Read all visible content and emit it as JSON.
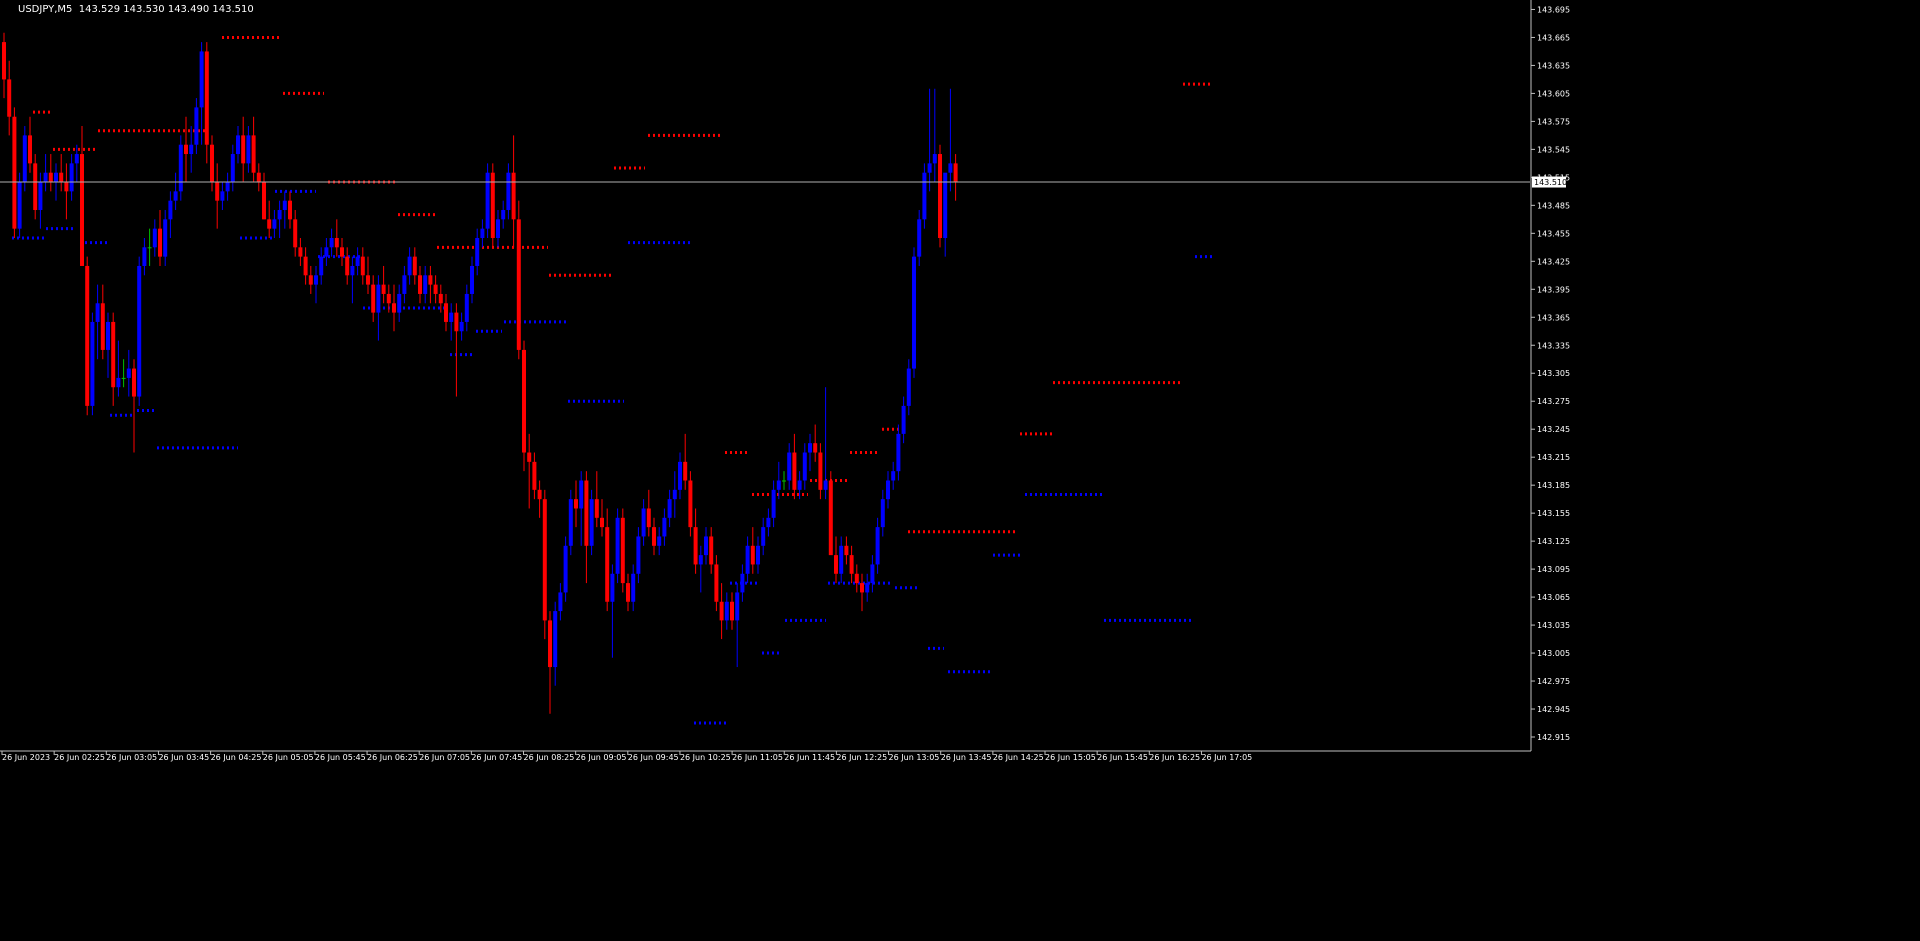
{
  "title": {
    "symbol": "USDJPY,M5",
    "ohlc": "143.529 143.530 143.490 143.510"
  },
  "colors": {
    "background": "#000000",
    "axis": "#c0c0c0",
    "text": "#ffffff",
    "bull": "#0000ff",
    "bear": "#ff0000",
    "doji": "#00c000",
    "bid_line": "#b0b0b0",
    "resistance": "#ff0000",
    "support": "#0000ff"
  },
  "chart_data": {
    "type": "candlestick",
    "symbol": "USDJPY",
    "timeframe": "M5",
    "ylim": [
      142.9,
      143.703
    ],
    "y_ticks": [
      "143.695",
      "143.665",
      "143.635",
      "143.605",
      "143.575",
      "143.545",
      "143.515",
      "143.485",
      "143.455",
      "143.425",
      "143.395",
      "143.365",
      "143.335",
      "143.305",
      "143.275",
      "143.245",
      "143.215",
      "143.185",
      "143.155",
      "143.125",
      "143.095",
      "143.065",
      "143.035",
      "143.005",
      "142.975",
      "142.945",
      "142.915"
    ],
    "x_ticks": [
      "26 Jun 2023",
      "26 Jun 02:25",
      "26 Jun 03:05",
      "26 Jun 03:45",
      "26 Jun 04:25",
      "26 Jun 05:05",
      "26 Jun 05:45",
      "26 Jun 06:25",
      "26 Jun 07:05",
      "26 Jun 07:45",
      "26 Jun 08:25",
      "26 Jun 09:05",
      "26 Jun 09:45",
      "26 Jun 10:25",
      "26 Jun 11:05",
      "26 Jun 11:45",
      "26 Jun 12:25",
      "26 Jun 13:05",
      "26 Jun 13:45",
      "26 Jun 14:25",
      "26 Jun 15:05",
      "26 Jun 15:45",
      "26 Jun 16:25",
      "26 Jun 17:05"
    ],
    "bid": "143.510",
    "candles": [
      [
        143.66,
        143.67,
        143.6,
        143.62
      ],
      [
        143.62,
        143.64,
        143.56,
        143.58
      ],
      [
        143.58,
        143.59,
        143.45,
        143.46
      ],
      [
        143.46,
        143.52,
        143.45,
        143.51
      ],
      [
        143.51,
        143.57,
        143.5,
        143.56
      ],
      [
        143.56,
        143.58,
        143.52,
        143.53
      ],
      [
        143.53,
        143.54,
        143.47,
        143.48
      ],
      [
        143.48,
        143.52,
        143.46,
        143.51
      ],
      [
        143.51,
        143.54,
        143.5,
        143.52
      ],
      [
        143.52,
        143.54,
        143.5,
        143.51
      ],
      [
        143.51,
        143.53,
        143.49,
        143.52
      ],
      [
        143.52,
        143.54,
        143.5,
        143.51
      ],
      [
        143.51,
        143.53,
        143.47,
        143.5
      ],
      [
        143.5,
        143.54,
        143.49,
        143.53
      ],
      [
        143.53,
        143.55,
        143.51,
        143.54
      ],
      [
        143.54,
        143.57,
        143.44,
        143.42
      ],
      [
        143.42,
        143.43,
        143.26,
        143.27
      ],
      [
        143.27,
        143.37,
        143.26,
        143.36
      ],
      [
        143.36,
        143.4,
        143.32,
        143.38
      ],
      [
        143.38,
        143.4,
        143.32,
        143.33
      ],
      [
        143.33,
        143.37,
        143.3,
        143.36
      ],
      [
        143.36,
        143.37,
        143.27,
        143.29
      ],
      [
        143.29,
        143.34,
        143.28,
        143.3
      ],
      [
        143.3,
        143.32,
        143.29,
        143.3
      ],
      [
        143.3,
        143.33,
        143.28,
        143.31
      ],
      [
        143.31,
        143.32,
        143.22,
        143.28
      ],
      [
        143.28,
        143.43,
        143.27,
        143.42
      ],
      [
        143.42,
        143.45,
        143.41,
        143.44
      ],
      [
        143.44,
        143.46,
        143.42,
        143.44
      ],
      [
        143.44,
        143.47,
        143.43,
        143.46
      ],
      [
        143.46,
        143.48,
        143.42,
        143.43
      ],
      [
        143.43,
        143.48,
        143.42,
        143.47
      ],
      [
        143.47,
        143.5,
        143.45,
        143.49
      ],
      [
        143.49,
        143.52,
        143.48,
        143.5
      ],
      [
        143.5,
        143.56,
        143.49,
        143.55
      ],
      [
        143.55,
        143.58,
        143.51,
        143.54
      ],
      [
        143.54,
        143.57,
        143.52,
        143.55
      ],
      [
        143.55,
        143.6,
        143.54,
        143.59
      ],
      [
        143.59,
        143.66,
        143.55,
        143.65
      ],
      [
        143.65,
        143.66,
        143.53,
        143.55
      ],
      [
        143.55,
        143.56,
        143.5,
        143.51
      ],
      [
        143.51,
        143.53,
        143.46,
        143.49
      ],
      [
        143.49,
        143.51,
        143.48,
        143.5
      ],
      [
        143.5,
        143.52,
        143.49,
        143.51
      ],
      [
        143.51,
        143.55,
        143.5,
        143.54
      ],
      [
        143.54,
        143.57,
        143.53,
        143.56
      ],
      [
        143.56,
        143.58,
        143.51,
        143.53
      ],
      [
        143.53,
        143.57,
        143.52,
        143.56
      ],
      [
        143.56,
        143.58,
        143.51,
        143.52
      ],
      [
        143.52,
        143.53,
        143.5,
        143.51
      ],
      [
        143.51,
        143.52,
        143.47,
        143.47
      ],
      [
        143.47,
        143.49,
        143.45,
        143.46
      ],
      [
        143.46,
        143.48,
        143.45,
        143.47
      ],
      [
        143.47,
        143.49,
        143.45,
        143.48
      ],
      [
        143.48,
        143.5,
        143.46,
        143.49
      ],
      [
        143.49,
        143.5,
        143.46,
        143.47
      ],
      [
        143.47,
        143.48,
        143.43,
        143.44
      ],
      [
        143.44,
        143.45,
        143.42,
        143.43
      ],
      [
        143.43,
        143.44,
        143.4,
        143.41
      ],
      [
        143.41,
        143.42,
        143.39,
        143.4
      ],
      [
        143.4,
        143.42,
        143.38,
        143.41
      ],
      [
        143.41,
        143.44,
        143.4,
        143.43
      ],
      [
        143.43,
        143.45,
        143.42,
        143.44
      ],
      [
        143.44,
        143.46,
        143.43,
        143.45
      ],
      [
        143.45,
        143.47,
        143.43,
        143.44
      ],
      [
        143.44,
        143.45,
        143.42,
        143.43
      ],
      [
        143.43,
        143.44,
        143.4,
        143.41
      ],
      [
        143.41,
        143.43,
        143.38,
        143.42
      ],
      [
        143.42,
        143.44,
        143.41,
        143.43
      ],
      [
        143.43,
        143.44,
        143.4,
        143.41
      ],
      [
        143.41,
        143.43,
        143.39,
        143.4
      ],
      [
        143.4,
        143.41,
        143.36,
        143.37
      ],
      [
        143.37,
        143.41,
        143.34,
        143.4
      ],
      [
        143.4,
        143.42,
        143.38,
        143.39
      ],
      [
        143.39,
        143.4,
        143.37,
        143.38
      ],
      [
        143.38,
        143.4,
        143.35,
        143.37
      ],
      [
        143.37,
        143.4,
        143.36,
        143.39
      ],
      [
        143.39,
        143.42,
        143.38,
        143.41
      ],
      [
        143.41,
        143.44,
        143.4,
        143.43
      ],
      [
        143.43,
        143.44,
        143.4,
        143.41
      ],
      [
        143.41,
        143.42,
        143.38,
        143.39
      ],
      [
        143.39,
        143.42,
        143.38,
        143.41
      ],
      [
        143.41,
        143.42,
        143.38,
        143.4
      ],
      [
        143.4,
        143.41,
        143.38,
        143.39
      ],
      [
        143.39,
        143.4,
        143.37,
        143.38
      ],
      [
        143.38,
        143.39,
        143.35,
        143.36
      ],
      [
        143.36,
        143.38,
        143.34,
        143.37
      ],
      [
        143.37,
        143.38,
        143.28,
        143.35
      ],
      [
        143.35,
        143.37,
        143.34,
        143.36
      ],
      [
        143.36,
        143.4,
        143.35,
        143.39
      ],
      [
        143.39,
        143.43,
        143.38,
        143.42
      ],
      [
        143.42,
        143.46,
        143.41,
        143.45
      ],
      [
        143.45,
        143.47,
        143.44,
        143.46
      ],
      [
        143.46,
        143.53,
        143.45,
        143.52
      ],
      [
        143.52,
        143.53,
        143.44,
        143.45
      ],
      [
        143.45,
        143.48,
        143.44,
        143.47
      ],
      [
        143.47,
        143.49,
        143.46,
        143.48
      ],
      [
        143.48,
        143.53,
        143.47,
        143.52
      ],
      [
        143.52,
        143.56,
        143.44,
        143.47
      ],
      [
        143.47,
        143.49,
        143.32,
        143.33
      ],
      [
        143.33,
        143.34,
        143.2,
        143.22
      ],
      [
        143.22,
        143.24,
        143.16,
        143.21
      ],
      [
        143.21,
        143.22,
        143.17,
        143.18
      ],
      [
        143.18,
        143.19,
        143.15,
        143.17
      ],
      [
        143.17,
        143.18,
        143.02,
        143.04
      ],
      [
        143.04,
        143.05,
        142.94,
        142.99
      ],
      [
        142.99,
        143.06,
        142.97,
        143.05
      ],
      [
        143.05,
        143.08,
        143.04,
        143.07
      ],
      [
        143.07,
        143.13,
        143.06,
        143.12
      ],
      [
        143.12,
        143.18,
        143.11,
        143.17
      ],
      [
        143.17,
        143.19,
        143.14,
        143.16
      ],
      [
        143.16,
        143.2,
        143.12,
        143.19
      ],
      [
        143.19,
        143.2,
        143.08,
        143.12
      ],
      [
        143.12,
        143.18,
        143.11,
        143.17
      ],
      [
        143.17,
        143.2,
        143.14,
        143.15
      ],
      [
        143.15,
        143.17,
        143.13,
        143.14
      ],
      [
        143.14,
        143.16,
        143.05,
        143.06
      ],
      [
        143.06,
        143.1,
        143.0,
        143.09
      ],
      [
        143.09,
        143.16,
        143.08,
        143.15
      ],
      [
        143.15,
        143.16,
        143.07,
        143.08
      ],
      [
        143.08,
        143.09,
        143.05,
        143.06
      ],
      [
        143.06,
        143.1,
        143.05,
        143.09
      ],
      [
        143.09,
        143.14,
        143.08,
        143.13
      ],
      [
        143.13,
        143.17,
        143.12,
        143.16
      ],
      [
        143.16,
        143.18,
        143.13,
        143.14
      ],
      [
        143.14,
        143.15,
        143.11,
        143.12
      ],
      [
        143.12,
        143.14,
        143.11,
        143.13
      ],
      [
        143.13,
        143.16,
        143.12,
        143.15
      ],
      [
        143.15,
        143.18,
        143.14,
        143.17
      ],
      [
        143.17,
        143.2,
        143.15,
        143.18
      ],
      [
        143.18,
        143.22,
        143.17,
        143.21
      ],
      [
        143.21,
        143.24,
        143.18,
        143.19
      ],
      [
        143.19,
        143.2,
        143.13,
        143.14
      ],
      [
        143.14,
        143.16,
        143.09,
        143.1
      ],
      [
        143.1,
        143.12,
        143.07,
        143.11
      ],
      [
        143.11,
        143.14,
        143.1,
        143.13
      ],
      [
        143.13,
        143.14,
        143.09,
        143.1
      ],
      [
        143.1,
        143.11,
        143.05,
        143.06
      ],
      [
        143.06,
        143.08,
        143.02,
        143.04
      ],
      [
        143.04,
        143.07,
        143.03,
        143.06
      ],
      [
        143.06,
        143.07,
        143.03,
        143.04
      ],
      [
        143.04,
        143.08,
        142.99,
        143.07
      ],
      [
        143.07,
        143.1,
        143.06,
        143.09
      ],
      [
        143.09,
        143.13,
        143.08,
        143.12
      ],
      [
        143.12,
        143.14,
        143.09,
        143.1
      ],
      [
        143.1,
        143.13,
        143.09,
        143.12
      ],
      [
        143.12,
        143.15,
        143.11,
        143.14
      ],
      [
        143.14,
        143.16,
        143.13,
        143.15
      ],
      [
        143.15,
        143.19,
        143.14,
        143.18
      ],
      [
        143.18,
        143.21,
        143.17,
        143.19
      ],
      [
        143.19,
        143.2,
        143.18,
        143.19
      ],
      [
        143.19,
        143.23,
        143.18,
        143.22
      ],
      [
        143.22,
        143.24,
        143.17,
        143.18
      ],
      [
        143.18,
        143.2,
        143.17,
        143.19
      ],
      [
        143.19,
        143.23,
        143.18,
        143.22
      ],
      [
        143.22,
        143.24,
        143.2,
        143.23
      ],
      [
        143.23,
        143.25,
        143.21,
        143.22
      ],
      [
        143.22,
        143.23,
        143.17,
        143.18
      ],
      [
        143.18,
        143.29,
        143.17,
        143.19
      ],
      [
        143.19,
        143.2,
        143.15,
        143.11
      ],
      [
        143.11,
        143.13,
        143.08,
        143.09
      ],
      [
        143.09,
        143.13,
        143.08,
        143.12
      ],
      [
        143.12,
        143.13,
        143.1,
        143.11
      ],
      [
        143.11,
        143.12,
        143.08,
        143.09
      ],
      [
        143.09,
        143.1,
        143.07,
        143.08
      ],
      [
        143.08,
        143.09,
        143.05,
        143.07
      ],
      [
        143.07,
        143.09,
        143.06,
        143.08
      ],
      [
        143.08,
        143.11,
        143.07,
        143.1
      ],
      [
        143.1,
        143.15,
        143.09,
        143.14
      ],
      [
        143.14,
        143.18,
        143.13,
        143.17
      ],
      [
        143.17,
        143.2,
        143.16,
        143.19
      ],
      [
        143.19,
        143.21,
        143.18,
        143.2
      ],
      [
        143.2,
        143.25,
        143.19,
        143.24
      ],
      [
        143.24,
        143.28,
        143.23,
        143.27
      ],
      [
        143.27,
        143.32,
        143.26,
        143.31
      ],
      [
        143.31,
        143.44,
        143.3,
        143.43
      ],
      [
        143.43,
        143.48,
        143.42,
        143.47
      ],
      [
        143.47,
        143.53,
        143.46,
        143.52
      ],
      [
        143.52,
        143.61,
        143.5,
        143.53
      ],
      [
        143.53,
        143.61,
        143.51,
        143.54
      ],
      [
        143.54,
        143.55,
        143.44,
        143.45
      ],
      [
        143.45,
        143.51,
        143.43,
        143.52
      ],
      [
        143.52,
        143.61,
        143.5,
        143.53
      ],
      [
        143.53,
        143.54,
        143.49,
        143.51
      ]
    ],
    "resistance_levels": [
      {
        "y": 143.585,
        "from": 33,
        "to": 50
      },
      {
        "y": 143.545,
        "from": 53,
        "to": 95
      },
      {
        "y": 143.565,
        "from": 98,
        "to": 208
      },
      {
        "y": 143.665,
        "from": 222,
        "to": 280
      },
      {
        "y": 143.605,
        "from": 283,
        "to": 324
      },
      {
        "y": 143.51,
        "from": 328,
        "to": 397
      },
      {
        "y": 143.475,
        "from": 398,
        "to": 436
      },
      {
        "y": 143.44,
        "from": 437,
        "to": 548
      },
      {
        "y": 143.41,
        "from": 549,
        "to": 613
      },
      {
        "y": 143.525,
        "from": 614,
        "to": 645
      },
      {
        "y": 143.56,
        "from": 648,
        "to": 723
      },
      {
        "y": 143.22,
        "from": 725,
        "to": 750
      },
      {
        "y": 143.175,
        "from": 752,
        "to": 808
      },
      {
        "y": 143.19,
        "from": 810,
        "to": 848
      },
      {
        "y": 143.22,
        "from": 850,
        "to": 880
      },
      {
        "y": 143.245,
        "from": 882,
        "to": 907
      },
      {
        "y": 143.135,
        "from": 908,
        "to": 1018
      },
      {
        "y": 143.24,
        "from": 1020,
        "to": 1052
      },
      {
        "y": 143.295,
        "from": 1053,
        "to": 1181
      },
      {
        "y": 143.615,
        "from": 1183,
        "to": 1213
      }
    ],
    "support_levels": [
      {
        "y": 143.45,
        "from": 12,
        "to": 44
      },
      {
        "y": 143.46,
        "from": 46,
        "to": 76
      },
      {
        "y": 143.445,
        "from": 80,
        "to": 108
      },
      {
        "y": 143.26,
        "from": 110,
        "to": 135
      },
      {
        "y": 143.265,
        "from": 137,
        "to": 155
      },
      {
        "y": 143.225,
        "from": 157,
        "to": 238
      },
      {
        "y": 143.45,
        "from": 240,
        "to": 272
      },
      {
        "y": 143.5,
        "from": 275,
        "to": 316
      },
      {
        "y": 143.43,
        "from": 318,
        "to": 362
      },
      {
        "y": 143.375,
        "from": 363,
        "to": 444
      },
      {
        "y": 143.325,
        "from": 450,
        "to": 474
      },
      {
        "y": 143.35,
        "from": 476,
        "to": 502
      },
      {
        "y": 143.36,
        "from": 504,
        "to": 567
      },
      {
        "y": 143.275,
        "from": 568,
        "to": 624
      },
      {
        "y": 143.445,
        "from": 628,
        "to": 690
      },
      {
        "y": 142.93,
        "from": 694,
        "to": 728
      },
      {
        "y": 143.08,
        "from": 730,
        "to": 758
      },
      {
        "y": 143.005,
        "from": 762,
        "to": 782
      },
      {
        "y": 143.04,
        "from": 785,
        "to": 826
      },
      {
        "y": 143.08,
        "from": 828,
        "to": 892
      },
      {
        "y": 143.075,
        "from": 895,
        "to": 920
      },
      {
        "y": 143.01,
        "from": 928,
        "to": 944
      },
      {
        "y": 142.985,
        "from": 948,
        "to": 990
      },
      {
        "y": 143.11,
        "from": 993,
        "to": 1022
      },
      {
        "y": 143.175,
        "from": 1025,
        "to": 1102
      },
      {
        "y": 143.04,
        "from": 1104,
        "to": 1193
      },
      {
        "y": 143.43,
        "from": 1195,
        "to": 1214
      }
    ]
  }
}
